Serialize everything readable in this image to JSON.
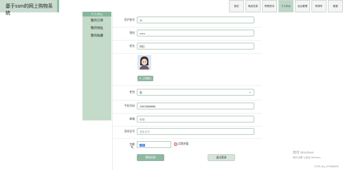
{
  "header": {
    "title": "基于ssm的网上购物系统"
  },
  "nav": [
    "首页",
    "商品信息",
    "购物资讯",
    "个人中心",
    "后台管理",
    "购物车",
    "客服"
  ],
  "sidebar": {
    "heading": "个人中心",
    "items": [
      "我的订单",
      "我的地址",
      "我的收藏"
    ]
  },
  "form": {
    "username_label": "用户账号",
    "username_value": "11",
    "password_label": "密码",
    "password_value": "••••••",
    "name_label": "姓名",
    "name_value": "徐红",
    "upload_label": "上传图片",
    "gender_label": "性别",
    "gender_value": "男",
    "phone_label": "手机号码",
    "phone_value": "13823888888",
    "email_label": "邮箱",
    "email_value": "邮箱",
    "idcard_label": "身份证号",
    "idcard_value": "身份证号",
    "balance_label": "余额",
    "balance_value": "100",
    "recharge_label": "点我充值"
  },
  "buttons": {
    "update": "更新信息",
    "logout": "退出登录"
  },
  "watermark": {
    "line1": "激活 Windows",
    "line2": "转到\"设置\"以激活 Windows。"
  },
  "credit": "CSDN @q_3375686806",
  "colors": {
    "accent": "#8fb7a2",
    "sidebar": "#c4dbc9",
    "active_nav": "#bcd7c6"
  }
}
